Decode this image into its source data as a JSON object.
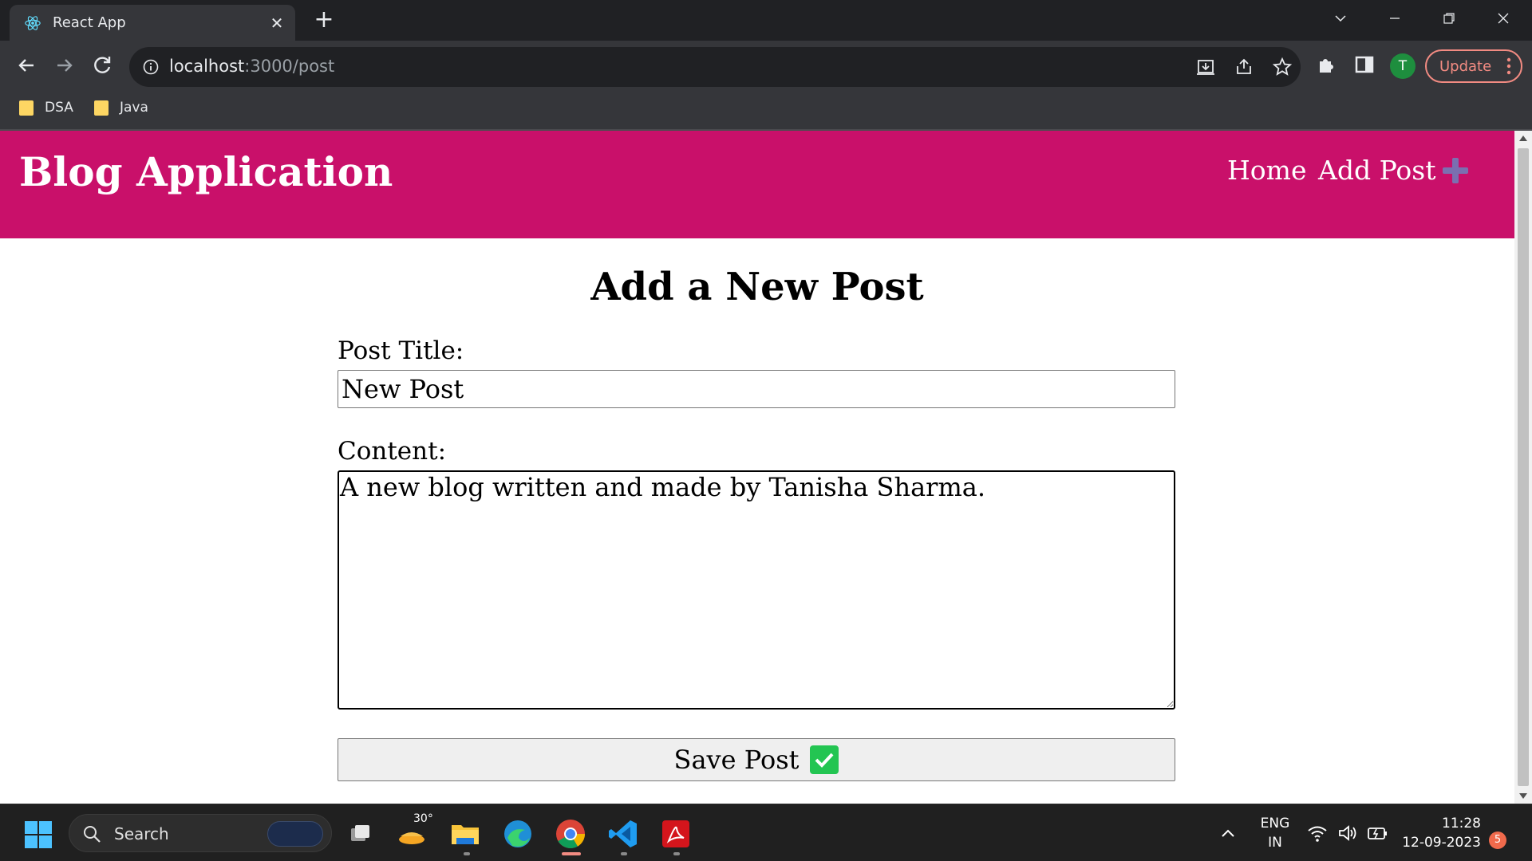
{
  "browser": {
    "tab_title": "React App",
    "url_host": "localhost",
    "url_path": ":3000/post",
    "profile_initial": "T",
    "update_label": "Update",
    "bookmarks": [
      {
        "label": "DSA"
      },
      {
        "label": "Java"
      }
    ]
  },
  "page": {
    "brand": "Blog Application",
    "nav": {
      "home": "Home",
      "add_post": "Add Post"
    },
    "heading": "Add a New Post",
    "form": {
      "title_label": "Post Title:",
      "title_value": "New Post",
      "content_label": "Content:",
      "content_value": "A new blog written and made by Tanisha Sharma.",
      "save_label": "Save Post"
    },
    "colors": {
      "navbar_bg": "#c9106a",
      "plus_icon": "#7b6fb0",
      "check_icon_bg": "#23c552"
    }
  },
  "taskbar": {
    "search_label": "Search",
    "weather_temp": "30°",
    "language": "ENG",
    "region": "IN",
    "time": "11:28",
    "date": "12-09-2023",
    "notifications": "5"
  }
}
